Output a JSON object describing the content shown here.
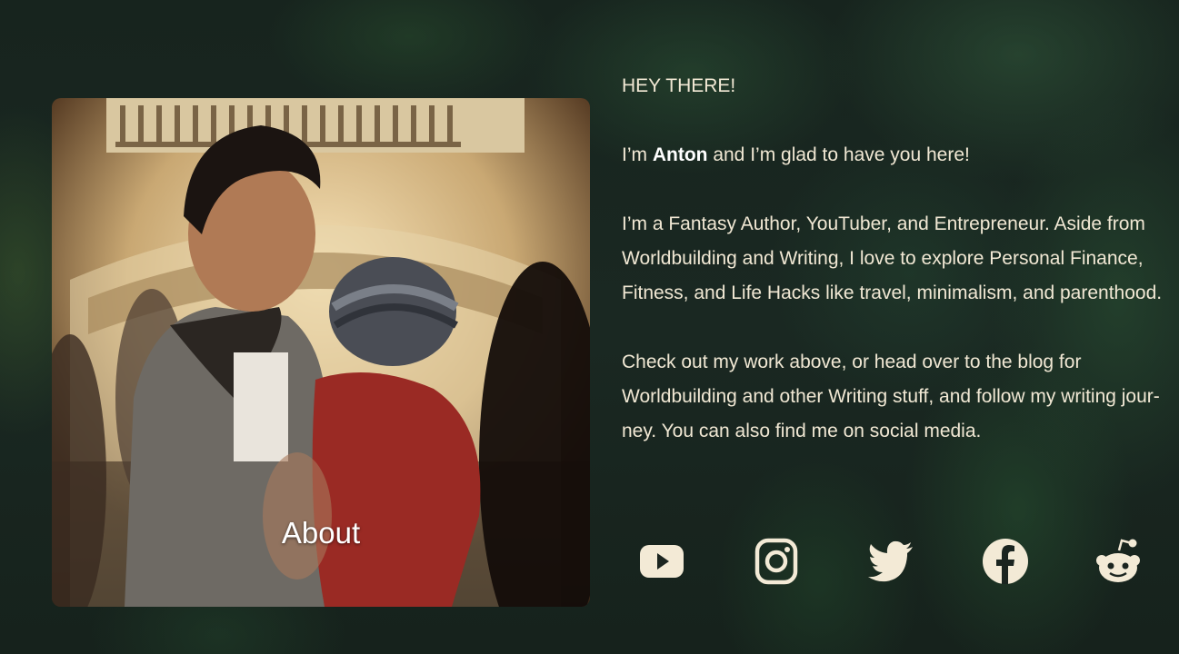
{
  "about_card": {
    "caption": "About"
  },
  "intro": {
    "greeting": "HEY THERE!",
    "line_prefix": "I’m ",
    "name": "Anton",
    "line_suffix": " and I’m glad to have you here!",
    "bio": "I’m a Fantasy Author, YouTuber, and Entrepreneur. Aside from Worldbuilding and Writing, I love to explore Personal Finance, Fitness, and Life Hacks like travel, minimalism, and parenthood.",
    "cta": "Check out my work above, or head over to the blog for Worldbuilding and other Writing stuff, and follow my writing jour­ney. You can also find me on social media."
  },
  "social": {
    "icons": [
      "youtube-icon",
      "instagram-icon",
      "twitter-icon",
      "facebook-icon",
      "reddit-icon"
    ],
    "icon_color": "#f3ead6"
  },
  "colors": {
    "text": "#f1e8d4",
    "background": "#17241e"
  }
}
